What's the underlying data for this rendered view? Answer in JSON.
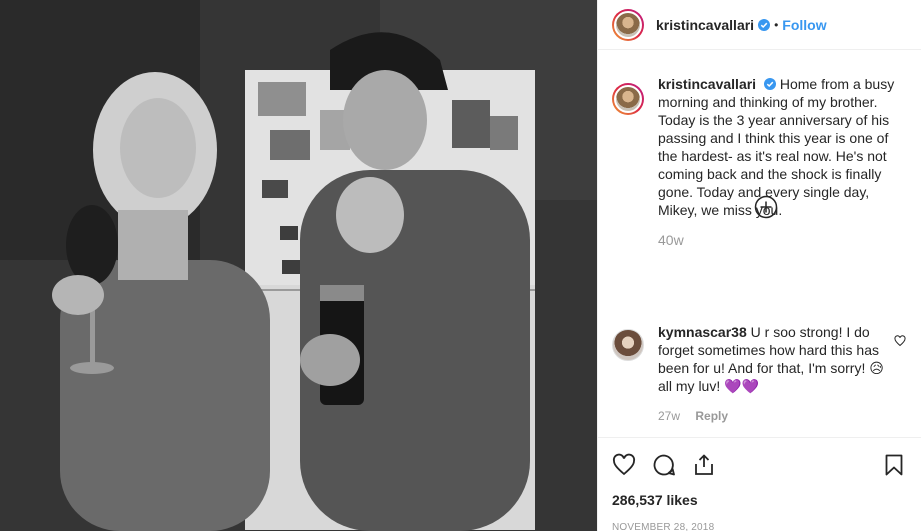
{
  "post": {
    "author": {
      "username": "kristincavallari",
      "verified": true,
      "follow_label": "Follow",
      "separator": "•"
    },
    "caption": {
      "username": "kristincavallari",
      "text": "Home from a busy morning and thinking of my brother. Today is the 3 year anniversary of his passing and I think this year is one of the hardest- as it's real now. He's not coming back and the shock is finally gone. Today and every single day, Mikey, we miss you.",
      "age": "40w"
    },
    "comments": [
      {
        "username": "kymnascar38",
        "text": "U r soo strong! I do forget sometimes how hard this has been for u! And for that, I'm sorry! 😥 all my luv! 💜💜",
        "age": "27w",
        "reply_label": "Reply"
      }
    ],
    "likes": "286,537 likes",
    "date": "NOVEMBER 28, 2018",
    "icons": {
      "like": "heart-icon",
      "comment": "comment-icon",
      "share": "share-icon",
      "save": "bookmark-icon",
      "load_more": "plus-circle-icon",
      "verified": "verified-badge-icon"
    },
    "colors": {
      "accent": "#3897f0",
      "verified": "#3897f0",
      "muted": "#999999",
      "text": "#262626"
    }
  }
}
